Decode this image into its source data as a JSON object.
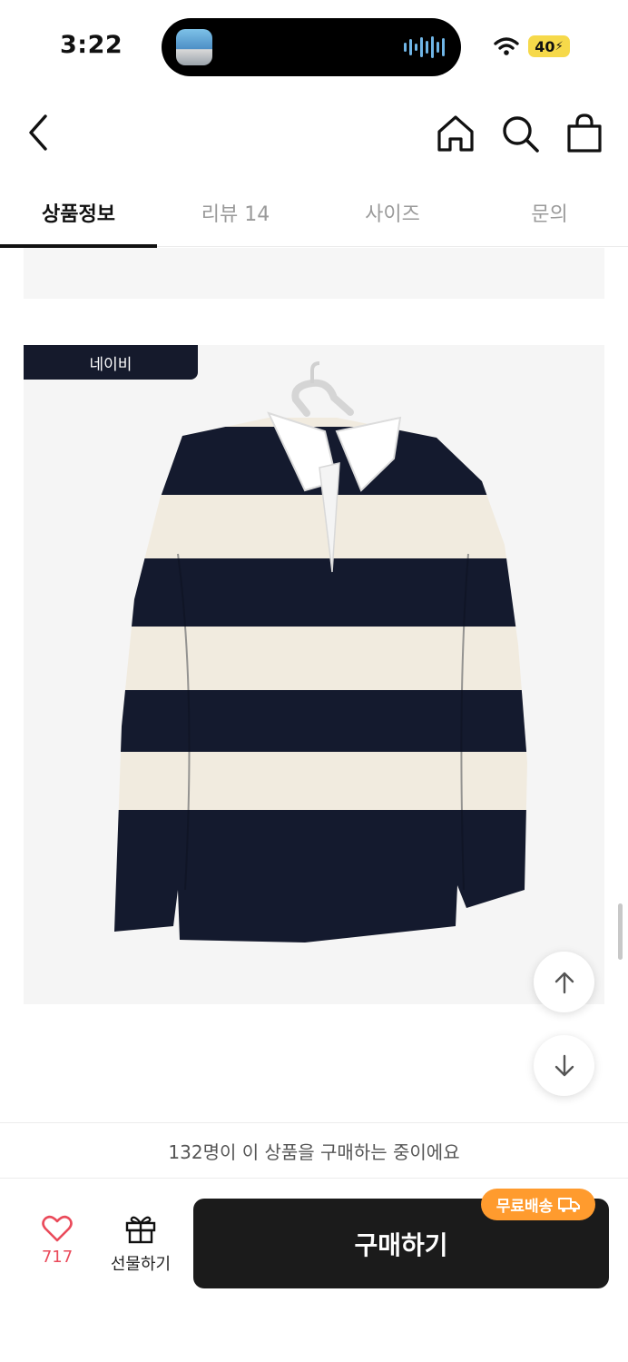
{
  "status_bar": {
    "time": "3:22",
    "battery": "40"
  },
  "tabs": [
    {
      "label": "상품정보",
      "active": true
    },
    {
      "label": "리뷰 14",
      "active": false
    },
    {
      "label": "사이즈",
      "active": false
    },
    {
      "label": "문의",
      "active": false
    }
  ],
  "product": {
    "color_label": "네이비"
  },
  "purchase_notice": "132명이 이 상품을 구매하는 중이에요",
  "bottom_bar": {
    "like_count": "717",
    "gift_label": "선물하기",
    "buy_label": "구매하기",
    "free_shipping_badge": "무료배송"
  },
  "colors": {
    "accent_like": "#ea4a5a",
    "badge": "#ff9b2e",
    "buy_button": "#1b1b1b",
    "label_bg": "#151a2c"
  }
}
